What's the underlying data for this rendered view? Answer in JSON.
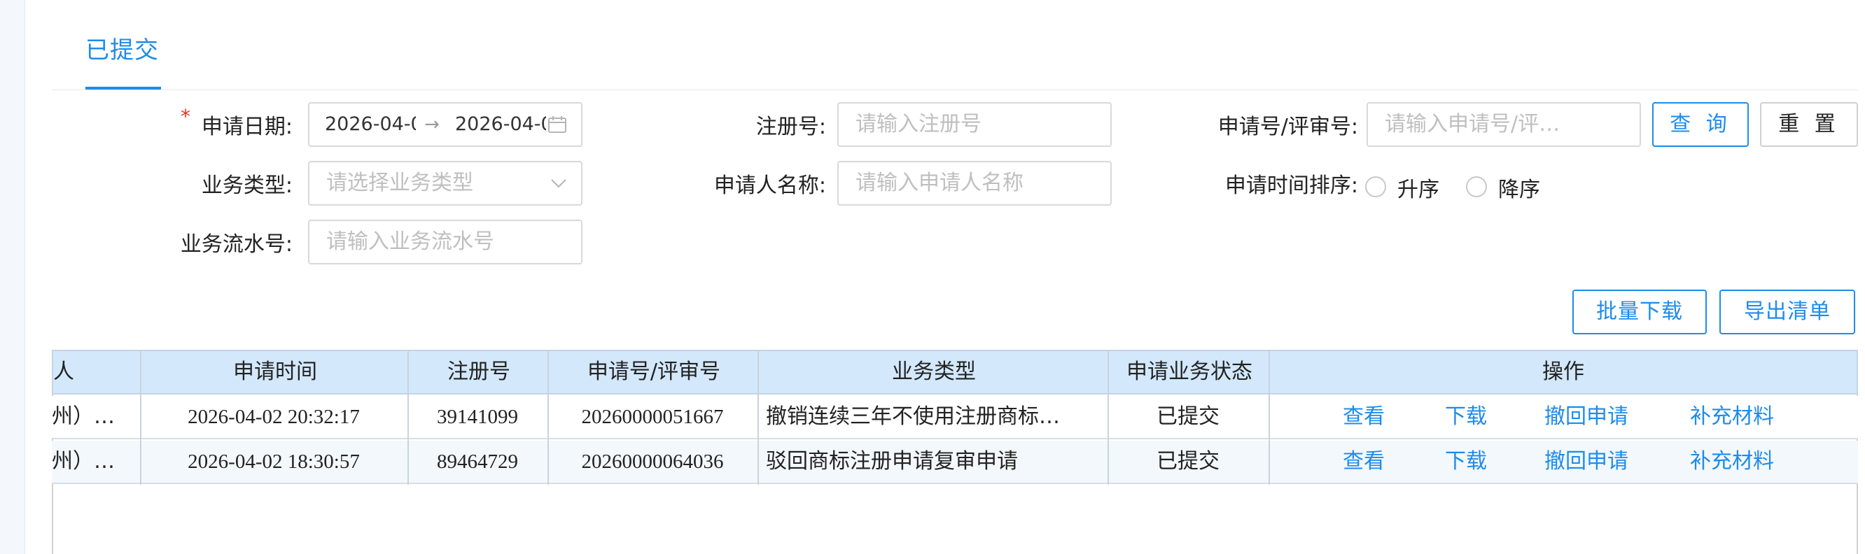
{
  "tab": {
    "label": "已提交"
  },
  "filters": {
    "apply_date": {
      "label": "申请日期:",
      "start": "2026-04-0",
      "end": "2026-04-0",
      "separator": "→"
    },
    "reg_no": {
      "label": "注册号:",
      "placeholder": "请输入注册号"
    },
    "app_no": {
      "label": "申请号/评审号:",
      "placeholder": "请输入申请号/评…"
    },
    "biz_type": {
      "label": "业务类型:",
      "placeholder": "请选择业务类型"
    },
    "applicant": {
      "label": "申请人名称:",
      "placeholder": "请输入申请人名称"
    },
    "sort": {
      "label": "申请时间排序:",
      "asc": "升序",
      "desc": "降序"
    },
    "serial": {
      "label": "业务流水号:",
      "placeholder": "请输入业务流水号"
    }
  },
  "buttons": {
    "query": "查 询",
    "reset": "重 置",
    "batch_download": "批量下载",
    "export_list": "导出清单"
  },
  "table": {
    "columns": [
      "人",
      "申请时间",
      "注册号",
      "申请号/评审号",
      "业务类型",
      "申请业务状态",
      "操作"
    ],
    "rows": [
      {
        "applicant": "州）…",
        "time": "2026-04-02 20:32:17",
        "reg_no": "39141099",
        "app_no": "20260000051667",
        "biz_type": "撤销连续三年不使用注册商标…",
        "status": "已提交"
      },
      {
        "applicant": "州）…",
        "time": "2026-04-02 18:30:57",
        "reg_no": "89464729",
        "app_no": "20260000064036",
        "biz_type": "驳回商标注册申请复审申请",
        "status": "已提交"
      }
    ],
    "actions": {
      "view": "查看",
      "download": "下载",
      "withdraw": "撤回申请",
      "supplement": "补充材料"
    }
  },
  "colors": {
    "accent": "#1d8cec",
    "header_bg": "#d3e8fb",
    "required": "#e5322d"
  },
  "icons": {
    "calendar": "calendar-icon",
    "dropdown": "chevron-down-icon"
  }
}
